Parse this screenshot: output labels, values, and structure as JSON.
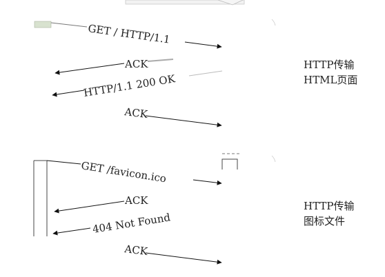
{
  "sections": [
    {
      "messages": [
        {
          "label": "GET / HTTP/1.1",
          "direction": "right"
        },
        {
          "label": "ACK",
          "direction": "left"
        },
        {
          "label": "HTTP/1.1 200 OK",
          "direction": "left"
        },
        {
          "label": "ACK",
          "direction": "right"
        }
      ],
      "note": {
        "line1": "HTTP传输",
        "line2": "HTML页面"
      }
    },
    {
      "messages": [
        {
          "label": "GET /favicon.ico",
          "direction": "right"
        },
        {
          "label": "ACK",
          "direction": "left"
        },
        {
          "label": "404 Not Found",
          "direction": "left"
        },
        {
          "label": "ACK",
          "direction": "right"
        }
      ],
      "note": {
        "line1": "HTTP传输",
        "line2": "图标文件"
      }
    }
  ]
}
